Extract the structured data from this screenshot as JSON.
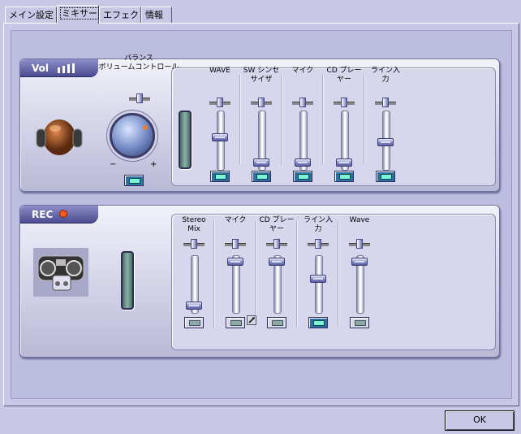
{
  "tabs": [
    {
      "label": "メイン設定",
      "active": false
    },
    {
      "label": "ミキサー",
      "active": true
    },
    {
      "label": "エフェクト",
      "active": false
    },
    {
      "label": "情報",
      "active": false
    }
  ],
  "playback": {
    "tag": "Vol",
    "master_label": "バランス\nボリュームコントロール",
    "knob_min": "−",
    "knob_max": "+",
    "channels": [
      {
        "label": "WAVE",
        "level": 0.55,
        "muted": true
      },
      {
        "label": "SW シンセ\nサイザ",
        "level": 0.05,
        "muted": true
      },
      {
        "label": "マイク",
        "level": 0.05,
        "muted": true
      },
      {
        "label": "CD プレー\nヤー",
        "level": 0.05,
        "muted": true
      },
      {
        "label": "ライン入\n力",
        "level": 0.45,
        "muted": true
      }
    ]
  },
  "record": {
    "tag": "REC",
    "channels": [
      {
        "label": "Stereo\nMix",
        "level": 0.05,
        "selected": false
      },
      {
        "label": "マイク",
        "level": 0.95,
        "selected": false
      },
      {
        "label": "CD プレー\nヤー",
        "level": 0.95,
        "selected": false
      },
      {
        "label": "ライン入\n力",
        "level": 0.6,
        "selected": true
      },
      {
        "label": "Wave",
        "level": 0.95,
        "selected": false
      }
    ]
  },
  "ok_label": "OK"
}
